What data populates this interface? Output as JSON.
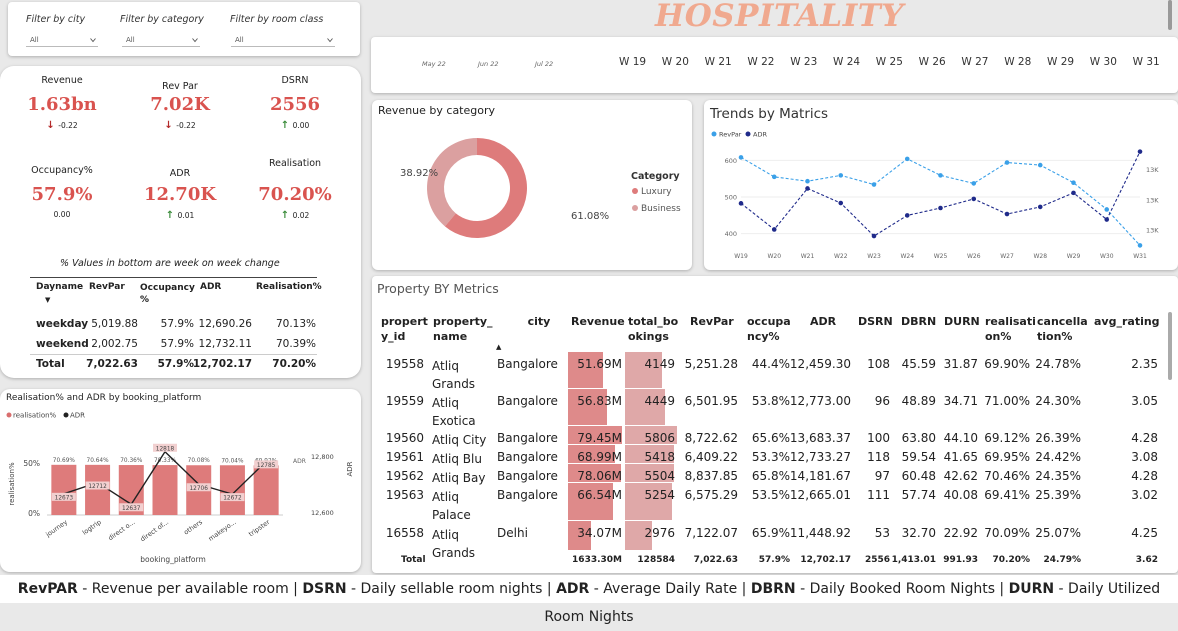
{
  "title": "HOSPITALITY",
  "filters": [
    {
      "label": "Filter by city",
      "value": "All"
    },
    {
      "label": "Filter by category",
      "value": "All"
    },
    {
      "label": "Filter by room class",
      "value": "All"
    }
  ],
  "timeline": {
    "dates": [
      "May 22",
      "Jun 22",
      "Jul 22"
    ],
    "weeks": [
      "W 19",
      "W 20",
      "W 21",
      "W 22",
      "W 23",
      "W 24",
      "W 25",
      "W 26",
      "W 27",
      "W 28",
      "W 29",
      "W 30",
      "W 31"
    ]
  },
  "kpis": [
    {
      "title": "Revenue",
      "value": "1.63bn",
      "change": "-0.22",
      "dir": "down"
    },
    {
      "title": "Rev Par",
      "value": "7.02K",
      "change": "-0.22",
      "dir": "down"
    },
    {
      "title": "DSRN",
      "value": "2556",
      "change": "0.00",
      "dir": "up"
    },
    {
      "title": "Occupancy%",
      "value": "57.9%",
      "change": "0.00",
      "dir": "none"
    },
    {
      "title": "ADR",
      "value": "12.70K",
      "change": "0.01",
      "dir": "up"
    },
    {
      "title": "Realisation",
      "value": "70.20%",
      "change": "0.02",
      "dir": "up"
    }
  ],
  "kpi_note": "%  Values in bottom are week on week change",
  "week_table": {
    "headers": [
      "Dayname",
      "RevPar",
      "Occupancy %",
      "ADR",
      "Realisation%"
    ],
    "rows": [
      [
        "weekday",
        "5,019.88",
        "57.9%",
        "12,690.26",
        "70.13%"
      ],
      [
        "weekend",
        "2,002.75",
        "57.9%",
        "12,732.11",
        "70.39%"
      ],
      [
        "Total",
        "7,022.63",
        "57.9%",
        "12,702.17",
        "70.20%"
      ]
    ]
  },
  "revenue_by_category": {
    "title": "Revenue by category",
    "legend_title": "Category",
    "labels": [
      "Luxury",
      "Business"
    ],
    "values": [
      61.08,
      38.92
    ],
    "value_labels": [
      "61.08%",
      "38.92%"
    ],
    "colors": [
      "#de7b7b",
      "#dba0a0"
    ]
  },
  "trends": {
    "title": "Trends by Matrics",
    "legend": [
      "RevPar",
      "ADR"
    ],
    "colors": [
      "#3aa0e8",
      "#1f2a8a"
    ]
  },
  "platform": {
    "title": "Realisation% and ADR by booking_platform",
    "legend": [
      "realisation%",
      "ADR"
    ],
    "ylabel": "realisation%",
    "y2label": "ADR",
    "xlabel": "booking_platform",
    "yticks": [
      "50%",
      "0%"
    ],
    "y2ticks": [
      "12,800",
      "12,600"
    ]
  },
  "property": {
    "title": "Property BY Metrics",
    "headers": [
      "propert y_id",
      "property_ name",
      "city",
      "Revenue",
      "total_bo okings",
      "RevPar",
      "occupa ncy%",
      "ADR",
      "DSRN",
      "DBRN",
      "DURN",
      "realisati on%",
      "cancella tion%",
      "avg_rating"
    ],
    "rows": [
      [
        "19558",
        "Atliq Grands",
        "Bangalore",
        "51.69M",
        "4149",
        "5,251.28",
        "44.4%",
        "12,459.30",
        "108",
        "45.59",
        "31.87",
        "69.90%",
        "24.78%",
        "2.35"
      ],
      [
        "19559",
        "Atliq Exotica",
        "Bangalore",
        "56.83M",
        "4449",
        "6,501.95",
        "53.8%",
        "12,773.00",
        "96",
        "48.89",
        "34.71",
        "71.00%",
        "24.30%",
        "3.05"
      ],
      [
        "19560",
        "Atliq City",
        "Bangalore",
        "79.45M",
        "5806",
        "8,722.62",
        "65.6%",
        "13,683.37",
        "100",
        "63.80",
        "44.10",
        "69.12%",
        "26.39%",
        "4.28"
      ],
      [
        "19561",
        "Atliq Blu",
        "Bangalore",
        "68.99M",
        "5418",
        "6,409.22",
        "53.3%",
        "12,733.27",
        "118",
        "59.54",
        "41.65",
        "69.95%",
        "24.42%",
        "3.08"
      ],
      [
        "19562",
        "Atliq Bay",
        "Bangalore",
        "78.06M",
        "5504",
        "8,837.85",
        "65.8%",
        "14,181.67",
        "97",
        "60.48",
        "42.62",
        "70.46%",
        "24.35%",
        "4.28"
      ],
      [
        "19563",
        "Atliq Palace",
        "Bangalore",
        "66.54M",
        "5254",
        "6,575.29",
        "53.5%",
        "12,665.01",
        "111",
        "57.74",
        "40.08",
        "69.41%",
        "25.39%",
        "3.02"
      ],
      [
        "16558",
        "Atliq Grands",
        "Delhi",
        "34.07M",
        "2976",
        "7,122.07",
        "65.9%",
        "11,448.92",
        "53",
        "32.70",
        "22.92",
        "70.09%",
        "25.07%",
        "4.25"
      ]
    ],
    "total": [
      "Total",
      "1633.30M",
      "128584",
      "7,022.63",
      "57.9%",
      "12,702.17",
      "2556",
      "1,413.01",
      "991.93",
      "70.20%",
      "24.79%",
      "3.62"
    ],
    "revenue_fill": [
      0.651,
      0.715,
      1.0,
      0.868,
      0.983,
      0.838,
      0.429
    ],
    "bookings_fill": [
      0.715,
      0.766,
      1.0,
      0.933,
      0.948,
      0.905,
      0.513
    ]
  },
  "footer": [
    {
      "term": "RevPAR",
      "desc": " - Revenue per available room | "
    },
    {
      "term": "DSRN",
      "desc": " - Daily sellable room nights | "
    },
    {
      "term": "ADR",
      "desc": " - Average Daily Rate | "
    },
    {
      "term": "DBRN",
      "desc": " - Daily Booked Room Nights | "
    },
    {
      "term": "DURN",
      "desc": " - Daily Utilized Room Nights"
    }
  ],
  "chart_data": [
    {
      "type": "pie",
      "title": "Revenue by category",
      "categories": [
        "Luxury",
        "Business"
      ],
      "values": [
        61.08,
        38.92
      ]
    },
    {
      "type": "line",
      "title": "Trends by Matrics",
      "categories": [
        "W 19",
        "W 20",
        "W 21",
        "W 22",
        "W 23",
        "W 24",
        "W 25",
        "W 26",
        "W 27",
        "W 28",
        "W 29",
        "W 30",
        "W 31"
      ],
      "yticks": [
        "600",
        "500",
        "400"
      ],
      "y2ticks": [
        "13K",
        "13K",
        "13K"
      ],
      "ylim": [
        350,
        650
      ],
      "y2lim": [
        12550,
        12950
      ],
      "series": [
        {
          "name": "RevPar",
          "values": [
            608,
            555,
            543,
            559,
            534,
            604,
            559,
            537,
            594,
            587,
            539,
            466,
            368
          ]
        },
        {
          "name": "ADR",
          "values": [
            12727,
            12632,
            12781,
            12728,
            12608,
            12683,
            12710,
            12743,
            12688,
            12714,
            12765,
            12668,
            12915
          ]
        }
      ]
    },
    {
      "type": "bar",
      "title": "Realisation% and ADR by booking_platform",
      "categories": [
        "journey",
        "logtrip",
        "direct o...",
        "direct of...",
        "others",
        "makeyo...",
        "tripster"
      ],
      "series": [
        {
          "name": "realisation%",
          "values": [
            70.69,
            70.64,
            70.36,
            70.33,
            70.08,
            70.04,
            69.92
          ]
        },
        {
          "name": "ADR",
          "values": [
            12673,
            12712,
            12637,
            12818,
            12706,
            12672,
            12785
          ]
        }
      ],
      "bar_labels": [
        "70.69%",
        "70.64%",
        "70.36%",
        "70.33%",
        "70.08%",
        "70.04%",
        "69.92%"
      ],
      "line_labels": [
        "12673",
        "12712",
        "12637",
        "12818",
        "12706",
        "12672",
        "12785"
      ],
      "ylim": [
        0,
        100
      ],
      "y2lim": [
        12600,
        12800
      ]
    }
  ]
}
